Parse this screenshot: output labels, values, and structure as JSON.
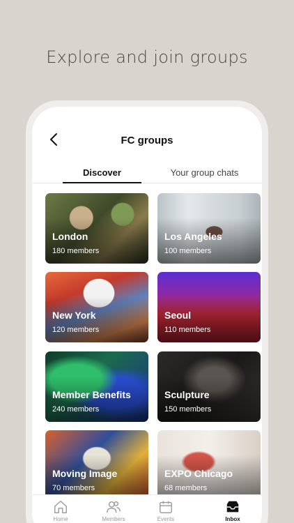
{
  "headline": "Explore and join groups",
  "header": {
    "title": "FC groups"
  },
  "tabs": [
    {
      "label": "Discover",
      "active": true
    },
    {
      "label": "Your group chats",
      "active": false
    }
  ],
  "groups": [
    {
      "name": "London",
      "members": "180 members"
    },
    {
      "name": "Los Angeles",
      "members": "100 members"
    },
    {
      "name": "New York",
      "members": "120 members"
    },
    {
      "name": "Seoul",
      "members": "110 members"
    },
    {
      "name": "Member Benefits",
      "members": "240 members"
    },
    {
      "name": "Sculpture",
      "members": "150 members"
    },
    {
      "name": "Moving Image",
      "members": "70 members"
    },
    {
      "name": "EXPO Chicago",
      "members": "68 members"
    }
  ],
  "nav": [
    {
      "label": "Home",
      "icon": "home-icon"
    },
    {
      "label": "Members",
      "icon": "members-icon"
    },
    {
      "label": "Events",
      "icon": "calendar-icon"
    },
    {
      "label": "Inbox",
      "icon": "inbox-icon",
      "active": true
    }
  ]
}
